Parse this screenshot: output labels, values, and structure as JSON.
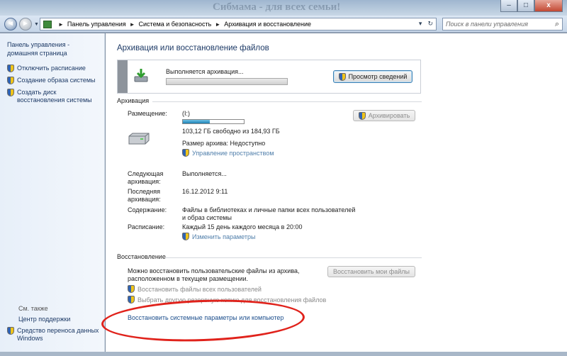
{
  "window": {
    "title": "Сибмама - для всех семьи!",
    "minimize": "–",
    "maximize": "□",
    "close": "x"
  },
  "toolbar": {
    "back_glyph": "◄",
    "forward_glyph": "►",
    "dropdown_glyph": "▼",
    "breadcrumbs": [
      "Панель управления",
      "Система и безопасность",
      "Архивация и восстановление"
    ],
    "breadcrumb_sep": "►",
    "address_dropdown": "▾",
    "refresh_glyph": "↻",
    "search_placeholder": "Поиск в панели управления",
    "search_icon": "⌕"
  },
  "sidebar": {
    "home": "Панель управления - домашняя страница",
    "items": [
      {
        "label": "Отключить расписание",
        "icon": "shield-icon"
      },
      {
        "label": "Создание образа системы",
        "icon": "shield-icon"
      },
      {
        "label": "Создать диск восстановления системы",
        "icon": "shield-icon"
      }
    ],
    "see_also": "См. также",
    "see_also_items": [
      {
        "label": "Центр поддержки",
        "icon": ""
      },
      {
        "label": "Средство переноса данных Windows",
        "icon": "shield-icon"
      }
    ]
  },
  "main": {
    "title": "Архивация или восстановление файлов",
    "progress": {
      "label": "Выполняется архивация...",
      "button": "Просмотр сведений",
      "fraction": 0.0
    },
    "backup": {
      "section": "Архивация",
      "location_label": "Размещение:",
      "location_value": "(I:)",
      "drive_used_fraction": 0.44,
      "free_space": "103,12 ГБ свободно из 184,93 ГБ",
      "archive_size": "Размер архива: Недоступно",
      "manage_space": "Управление пространством",
      "archive_button": "Архивировать",
      "next_label": "Следующая архивация:",
      "next_value": "Выполняется...",
      "last_label": "Последняя архивация:",
      "last_value": "16.12.2012 9:11",
      "contents_label": "Содержание:",
      "contents_value": "Файлы в библиотеках и личные папки всех пользователей и образ системы",
      "schedule_label": "Расписание:",
      "schedule_value": "Каждый 15 день каждого месяца в 20:00",
      "change_settings": "Изменить параметры"
    },
    "restore": {
      "section": "Восстановление",
      "description": "Можно восстановить пользовательские файлы из архива, расположенном в текущем размещении.",
      "restore_my_files_button": "Восстановить мои файлы",
      "restore_all_users": "Восстановить файлы всех пользователей",
      "choose_other_backup": "Выбрать другую резервную копию для восстановления файлов",
      "restore_system": "Восстановить системные параметры или компьютер"
    }
  },
  "colors": {
    "link": "#1c4e8c",
    "highlight_ellipse": "#e0221b",
    "sidebar_bg": "#e7eff9"
  }
}
